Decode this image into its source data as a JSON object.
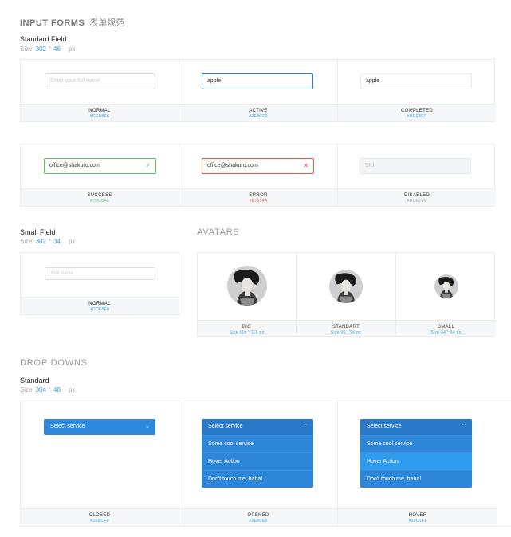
{
  "input_forms": {
    "title": "INPUT FORMS",
    "title_cn": "表单规范",
    "standard": {
      "label": "Standard Field",
      "size_prefix": "Size",
      "w": "302",
      "x": "*",
      "h": "46",
      "unit": "px"
    },
    "row1": [
      {
        "value": "Enter your full name",
        "state": "NORMAL",
        "hex": "#CED8E6"
      },
      {
        "value": "apple",
        "state": "ACTIVE",
        "hex": "#2E8CE0"
      },
      {
        "value": "apple",
        "state": "COMPLETED",
        "hex": "#DDE3EF"
      }
    ],
    "row2": [
      {
        "value": "office@shakuro.com",
        "state": "SUCCESS",
        "hex": "#7DC8A6",
        "icon": "✓"
      },
      {
        "value": "office@shakuro.com",
        "state": "ERROR",
        "hex": "#E7554A",
        "icon": "✕"
      },
      {
        "value": "SKI",
        "state": "DISABLED",
        "hex": "#DDE1E6"
      }
    ],
    "small": {
      "label": "Small Field",
      "size_prefix": "Size",
      "w": "302",
      "x": "*",
      "h": "34",
      "unit": "px",
      "value": "Your name",
      "state": "NORMAL",
      "hex": "#DDE8F0"
    }
  },
  "avatars": {
    "title": "AVATARS",
    "items": [
      {
        "label": "BIG",
        "size": "Size 116 * 116 px"
      },
      {
        "label": "STANDART",
        "size": "Size 96 * 96 px"
      },
      {
        "label": "SMALL",
        "size": "Size 64 * 64 px"
      }
    ]
  },
  "dropdowns": {
    "title": "DROP DOWNS",
    "standard": {
      "label": "Standard",
      "size_prefix": "Size",
      "w": "304",
      "x": "*",
      "h": "48",
      "unit": "px"
    },
    "head_label": "Select service",
    "options": [
      "Some cool service",
      "Hover Action",
      "Don't touch me, haha!"
    ],
    "states": [
      {
        "state": "CLOSED",
        "hex": "#2E8CE0"
      },
      {
        "state": "OPENED",
        "hex": "#2E8CE0"
      },
      {
        "state": "HOVER",
        "hex": "#38C1F1"
      }
    ]
  }
}
